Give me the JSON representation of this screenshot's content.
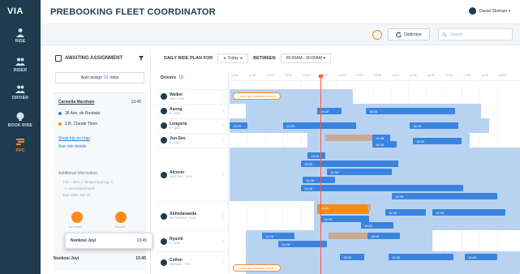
{
  "app": {
    "logo": "VIA",
    "title": "PREBOOKING FLEET COORDINATOR",
    "user": "Daniel Shoham ▾"
  },
  "colors": {
    "sidebar": "#1f3b4f",
    "accent": "#ff8a1c",
    "bar_blue": "#3a84e0",
    "bar_light": "#b8d3f2",
    "now_line": "#ff5a3c"
  },
  "nav": [
    {
      "label": "RIDE",
      "icon": "person-icon"
    },
    {
      "label": "RIDER",
      "icon": "riders-icon"
    },
    {
      "label": "DRIVER",
      "icon": "driver-icon"
    },
    {
      "label": "BOOK RIDE",
      "icon": "book-ride-icon"
    },
    {
      "label": "PPC",
      "icon": "ppc-icon",
      "active": true
    }
  ],
  "toolbar": {
    "optimize_label": "Optimize",
    "search_placeholder": "Search"
  },
  "panel": {
    "title": "AWAITING ASSIGNMENT",
    "auto_assign_prefix": "Auto assign",
    "auto_assign_count": "23",
    "auto_assign_suffix": "rides",
    "rider": {
      "name": "Carmella Marsham",
      "time": "13:45",
      "pickup": "36 Ave. de Roubaix",
      "dropoff": "2 R. Claude Thion",
      "show_map": "Show trip on map",
      "details": "See ride details",
      "info_title": "Additional information",
      "info_lines": [
        "FM + 35% + Temporary(Aug 7)",
        "+1 accompaniment",
        "Exp date: Jun 21"
      ],
      "action_1": "Aco acces",
      "action_2": "Support"
    },
    "dragging": {
      "name": "Nonkosi Joyi",
      "time": "13:45"
    },
    "next": {
      "name": "Nonkosi Joyi",
      "time": "13:45"
    }
  },
  "plan": {
    "title": "DAILY RIDE PLAN FOR",
    "day": "Today",
    "between_label": "BETWEEN",
    "range": "00:00AM - 00:00AM ▾"
  },
  "drivers": {
    "label": "Drivers",
    "count": "18",
    "list": [
      {
        "name": "Walker",
        "sub": "Ford · 4295"
      },
      {
        "name": "Asong",
        "sub": "8 · 4295"
      },
      {
        "name": "Longoria",
        "sub": "8 · 4295"
      },
      {
        "name": "Jun-Seo",
        "sub": "8 · 7901"
      },
      {
        "name": "Alcocer",
        "sub": "ELECTRIC · 4415"
      },
      {
        "name": "Abhedananda",
        "sub": "MOTORBIKE · 4415"
      },
      {
        "name": "Ryuchi",
        "sub": "8 · 4295"
      },
      {
        "name": "Colton",
        "sub": "MINIVAN · 7733"
      }
    ]
  },
  "timeline": {
    "hours": [
      "11:00",
      "11:30",
      "12:00",
      "12:30",
      "13:00",
      "13:30",
      "14:00",
      "14:30",
      "15:00",
      "15:30",
      "16:00",
      "16:30",
      "17:00",
      "17:30",
      "18:00",
      "18:30"
    ],
    "bubble_text": "1 more spot available before ▸",
    "times": {
      "t1": "14:08",
      "t2": "18:28",
      "t3": "16:28",
      "t4": "14:38",
      "t5": "18:28",
      "t6": "14:38",
      "t7": "16:28",
      "t8": "18:33",
      "t9": "14:38",
      "t10": "15:53",
      "t11": "14:38",
      "t12": "14:28",
      "t13": "14:28",
      "t14": "14:38",
      "t15": "18:28",
      "t16": "16:08",
      "t17": "14:28",
      "t18": "15:28",
      "t19": "15:23",
      "t20": "14:28",
      "t21": "16:38",
      "t22": "14:08",
      "t23": "18:28",
      "t24": "11:28",
      "t25": "14:38"
    }
  }
}
